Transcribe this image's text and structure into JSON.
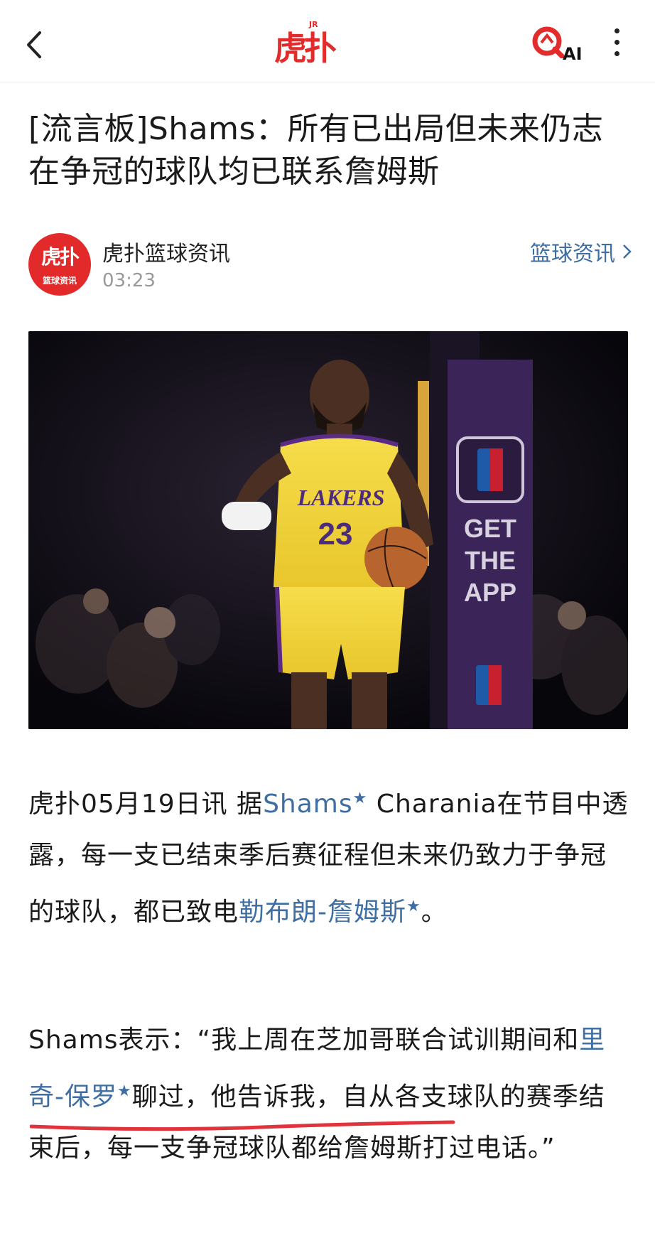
{
  "topbar": {
    "logo_text": "虎扑",
    "logo_badge": "JR",
    "ai_label": "AI"
  },
  "article": {
    "title": "[流言板]Shams：所有已出局但未来仍志在争冠的球队均已联系詹姆斯",
    "author": {
      "name": "虎扑篮球资讯",
      "time": "03:23",
      "avatar_text": "虎扑",
      "avatar_subtext": "篮球资讯"
    },
    "channel": "篮球资讯",
    "image": {
      "jersey_team": "LAKERS",
      "jersey_number": "23",
      "banner_lines": [
        "GET",
        "THE",
        "APP"
      ]
    },
    "paragraph1": {
      "text1": "虎扑05月19日讯 据",
      "link1": "Shams",
      "text2": " Charania在节目中透露，每一支已结束季后赛征程但未来仍致力于争冠的球队，都已致电",
      "link2": "勒布朗-詹姆斯",
      "text3": "。"
    },
    "paragraph2": {
      "text1": "Shams表示：“我上周在芝加哥联合试训期间和",
      "link1": "里奇-保罗",
      "text2": "聊过，他告诉我，自从各支球队的赛季结束后，每一支争冠球队都给詹姆斯打过电话。”"
    },
    "star_glyph": "★"
  },
  "colors": {
    "brand_red": "#e22b2b",
    "link_blue": "#3f6ea3",
    "underline_red": "#e0333b"
  }
}
